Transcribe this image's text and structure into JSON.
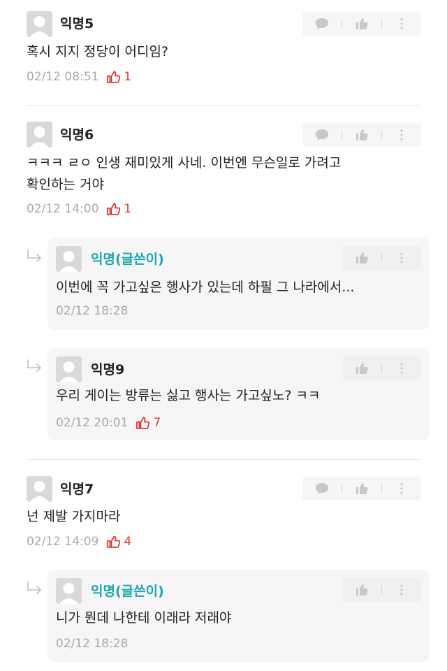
{
  "icons": {
    "avatar": "default-avatar-icon",
    "comment": "speech-bubble-icon",
    "like": "thumbs-up-icon",
    "more": "vertical-dots-icon",
    "reply_arrow": "reply-arrow-icon",
    "vote": "thumbs-up-outline-icon"
  },
  "colors": {
    "op_author": "#1ba7b1",
    "vote": "#e0362f",
    "meta": "#a9a9a9",
    "reply_bg": "#f6f6f6"
  },
  "comments": [
    {
      "author": "익명5",
      "lines": [
        "혹시 지지 정당이 어디임?"
      ],
      "time": "02/12 08:51",
      "votes": "1"
    },
    {
      "author": "익명6",
      "lines": [
        "ㅋㅋㅋ ㄹㅇ 인생 재미있게 사네. 이번엔 무슨일로 가려고",
        "확인하는 거야"
      ],
      "time": "02/12 14:00",
      "votes": "1",
      "replies": [
        {
          "author": "익명(글쓴이)",
          "lines": [
            "이번에 꼭 가고싶은 행사가 있는데 하필 그 나라에서..."
          ],
          "time": "02/12 18:28"
        },
        {
          "author": "익명9",
          "lines": [
            "우리 게이는 방류는 싫고 행사는 가고싶노? ㅋㅋ"
          ],
          "time": "02/12 20:01",
          "votes": "7"
        }
      ]
    },
    {
      "author": "익명7",
      "lines": [
        "넌 제발 가지마라"
      ],
      "time": "02/12 14:09",
      "votes": "4",
      "replies": [
        {
          "author": "익명(글쓴이)",
          "lines": [
            "니가 뭔데 나한테 이래라 저래야"
          ],
          "time": "02/12 18:28"
        }
      ]
    }
  ]
}
